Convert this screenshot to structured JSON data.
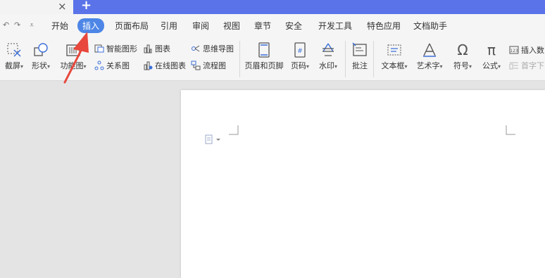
{
  "titlebar": {
    "close_glyph": "×",
    "new_tab_glyph": "+"
  },
  "quick_access": {
    "undo_glyph": "↶",
    "redo_glyph": "↷",
    "more_glyph": "⩡"
  },
  "menu": {
    "items": [
      {
        "label": "开始"
      },
      {
        "label": "插入",
        "active": true
      },
      {
        "label": "页面布局"
      },
      {
        "label": "引用"
      },
      {
        "label": "审阅"
      },
      {
        "label": "视图"
      },
      {
        "label": "章节"
      },
      {
        "label": "安全"
      },
      {
        "label": "开发工具"
      },
      {
        "label": "特色应用"
      },
      {
        "label": "文档助手"
      }
    ]
  },
  "ribbon": {
    "screenshot": "截屏",
    "shape": "形状",
    "function_chart": "功能图",
    "smart_art": "智能图形",
    "chart": "图表",
    "relation_chart": "关系图",
    "online_chart": "在线图表",
    "mind_map": "思维导图",
    "flowchart": "流程图",
    "header_footer": "页眉和页脚",
    "page_number": "页码",
    "watermark": "水印",
    "comment": "批注",
    "text_box": "文本框",
    "word_art": "艺术字",
    "symbol": "符号",
    "formula": "公式",
    "insert_number": "插入数",
    "first_letter": "首字下"
  },
  "colors": {
    "accent": "#4d86e6",
    "titlebar_blue": "#5a73e8",
    "arrow": "#e8473c"
  }
}
